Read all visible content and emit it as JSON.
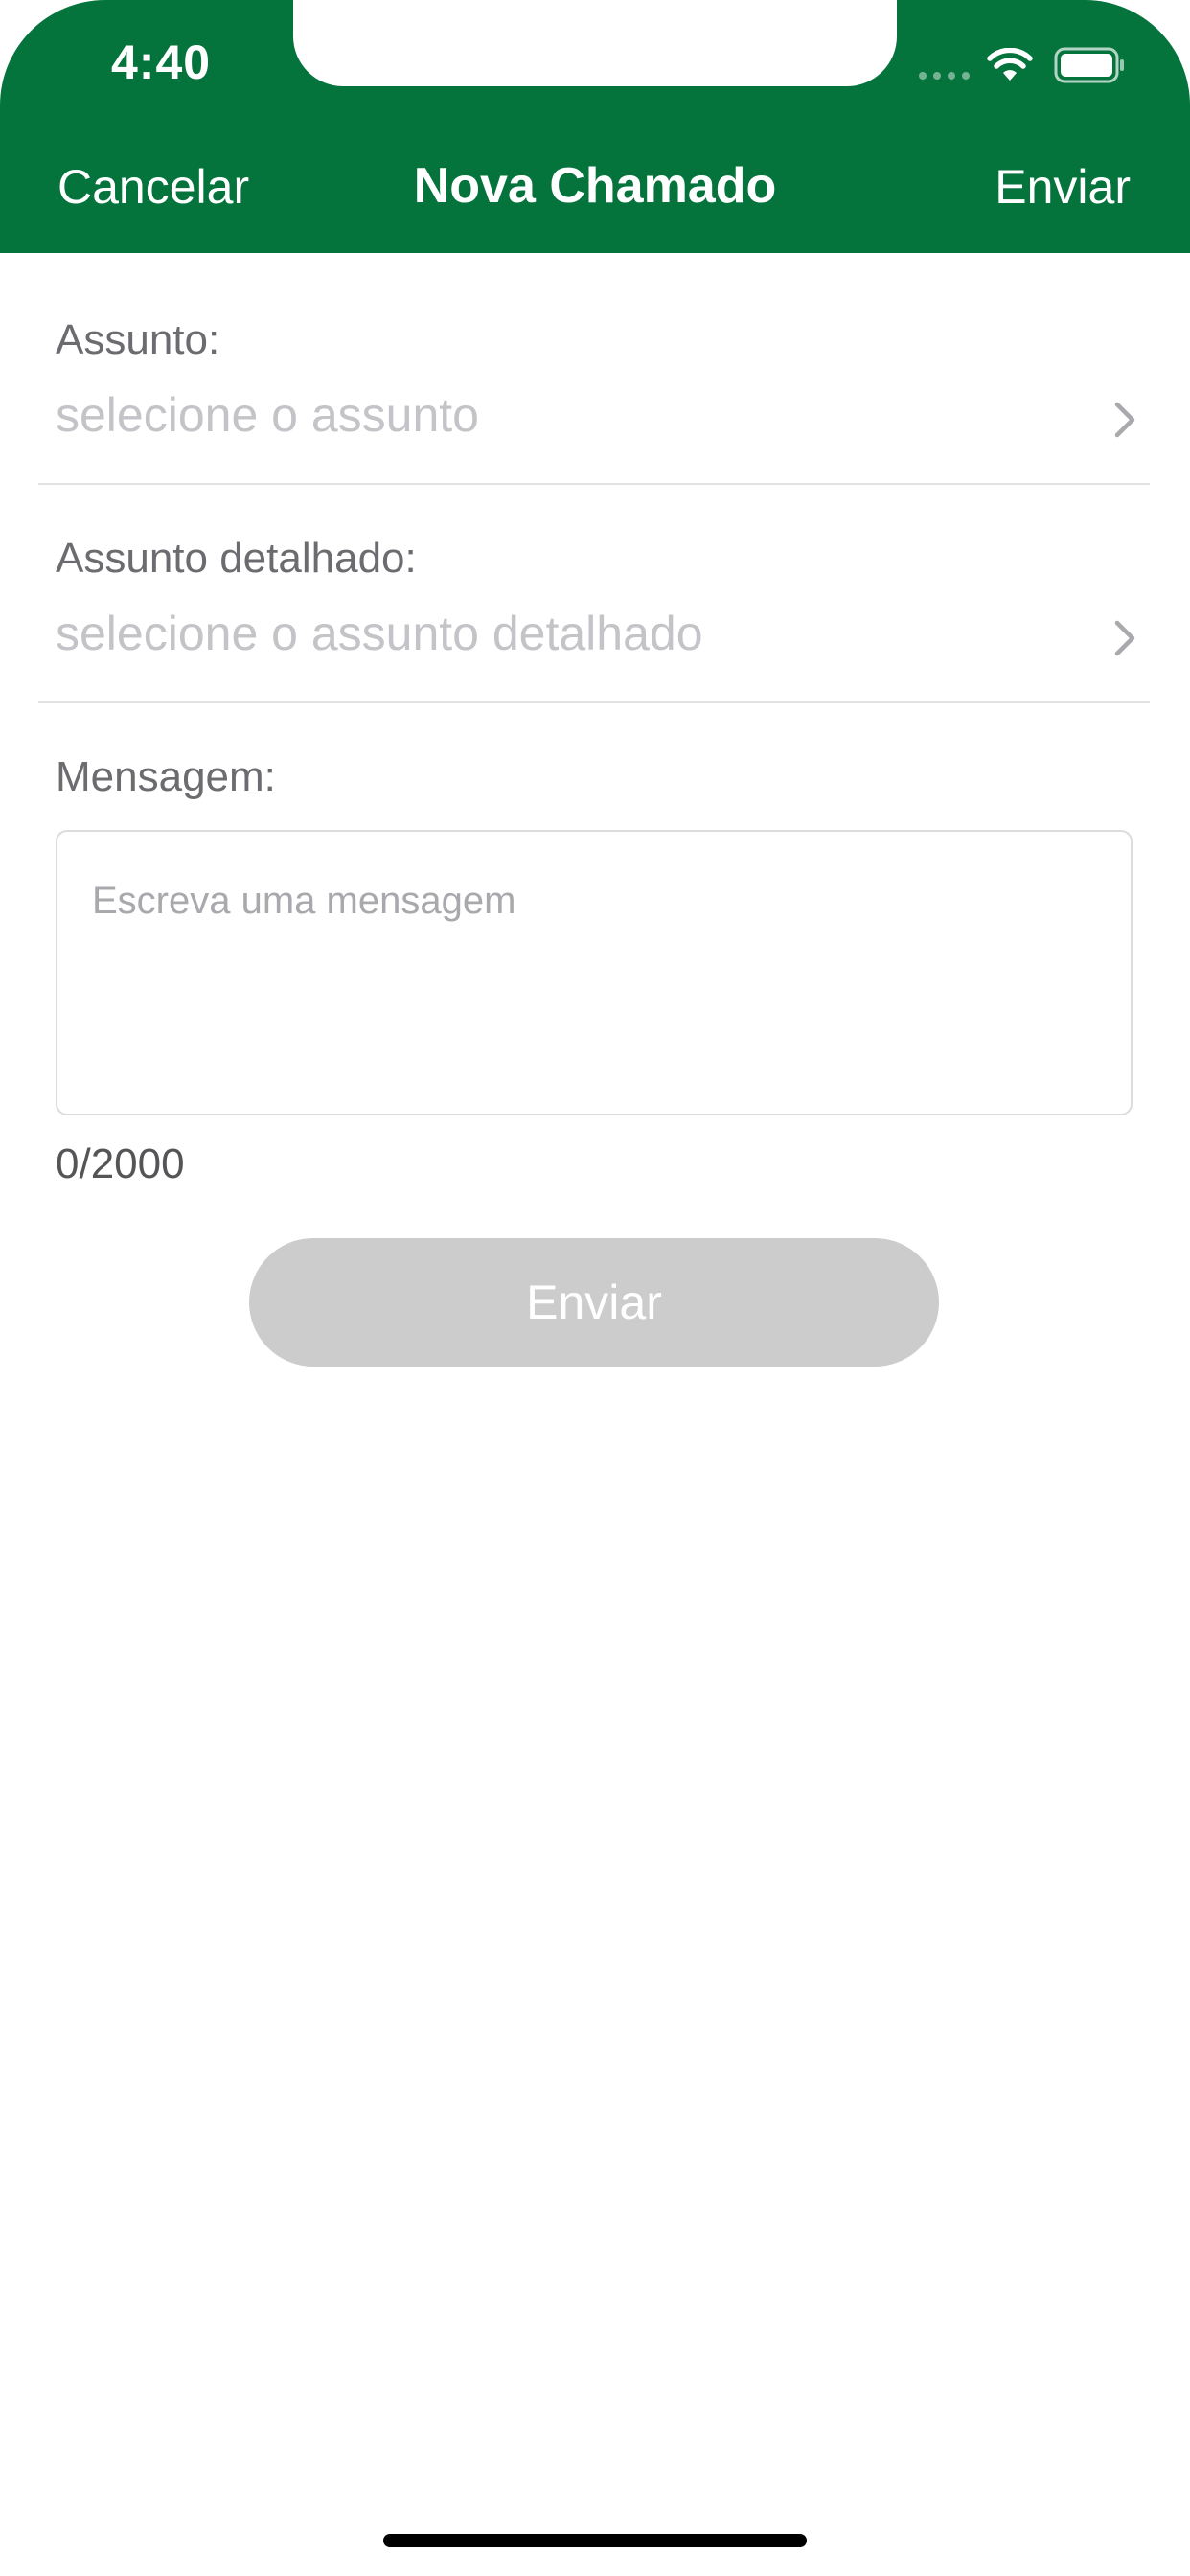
{
  "status_bar": {
    "time": "4:40"
  },
  "nav": {
    "cancel_label": "Cancelar",
    "title": "Nova Chamado",
    "send_label": "Enviar"
  },
  "form": {
    "subject": {
      "label": "Assunto:",
      "placeholder": "selecione o assunto"
    },
    "detailed_subject": {
      "label": "Assunto detalhado:",
      "placeholder": "selecione o assunto detalhado"
    },
    "message": {
      "label": "Mensagem:",
      "placeholder": "Escreva uma mensagem",
      "value": "",
      "counter": "0/2000"
    },
    "submit_label": "Enviar"
  },
  "colors": {
    "header_green": "#04733c",
    "disabled_button": "#cccccc"
  },
  "icons": {
    "chevron": "chevron-right-icon",
    "wifi": "wifi-icon",
    "battery": "battery-icon",
    "signal": "cellular-signal-icon"
  }
}
